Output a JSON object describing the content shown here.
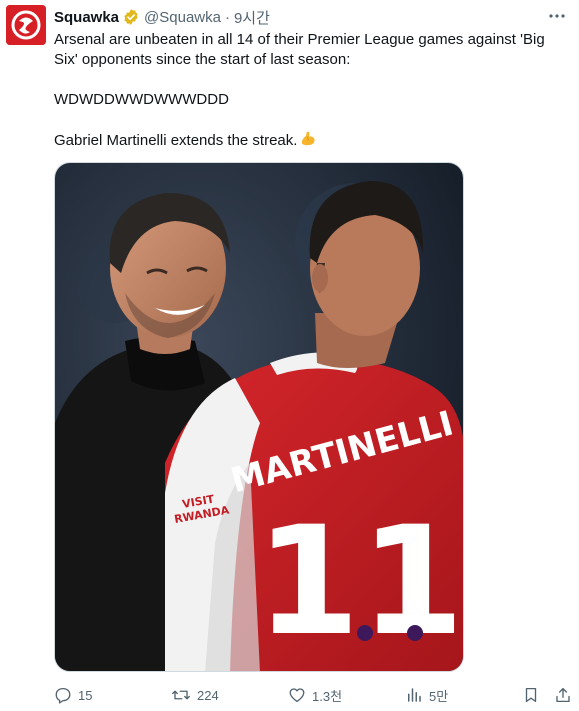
{
  "author": {
    "display_name": "Squawka",
    "handle": "@Squawka",
    "separator": "·",
    "timestamp": "9시간",
    "verified_icon": "verified-badge-icon",
    "brand_color": "#d71f26"
  },
  "tweet": {
    "line1": "Arsenal are unbeaten in all 14 of their Premier League games against 'Big Six' opponents since the start of last season:",
    "line2": "WDWDDWWDWWWDDD",
    "line3": "Gabriel Martinelli extends the streak.",
    "emoji": "flexed-biceps-icon"
  },
  "media": {
    "jersey_name": "MARTINELLI",
    "jersey_number": "11",
    "sleeve_text_1": "VISIT",
    "sleeve_text_2": "RWANDA"
  },
  "actions": {
    "replies": "15",
    "retweets": "224",
    "likes": "1.3천",
    "views": "5만"
  },
  "colors": {
    "text_primary": "#0f1419",
    "text_secondary": "#536471",
    "border": "#cfd9de",
    "verified_gold": "#e2b719"
  }
}
